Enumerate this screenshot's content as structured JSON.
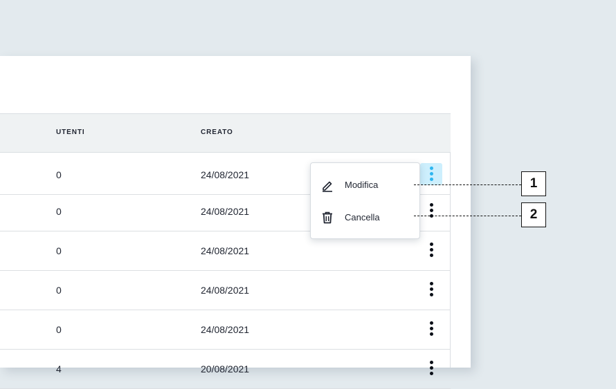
{
  "table": {
    "headers": {
      "users": "UTENTI",
      "created": "CREATO"
    },
    "rows": [
      {
        "users": "0",
        "created": "24/08/2021"
      },
      {
        "users": "0",
        "created": "24/08/2021"
      },
      {
        "users": "0",
        "created": "24/08/2021"
      },
      {
        "users": "0",
        "created": "24/08/2021"
      },
      {
        "users": "0",
        "created": "24/08/2021"
      },
      {
        "users": "4",
        "created": "20/08/2021"
      }
    ]
  },
  "context_menu": {
    "items": [
      {
        "label": "Modifica",
        "icon": "pencil-icon"
      },
      {
        "label": "Cancella",
        "icon": "trash-icon"
      }
    ]
  },
  "callouts": [
    "1",
    "2"
  ],
  "colors": {
    "background": "#e3eaee",
    "header_bg": "#eff2f3",
    "active_kebab_bg": "#cdeffd",
    "active_kebab_dots": "#2eb6f0",
    "text": "#1f2430"
  }
}
